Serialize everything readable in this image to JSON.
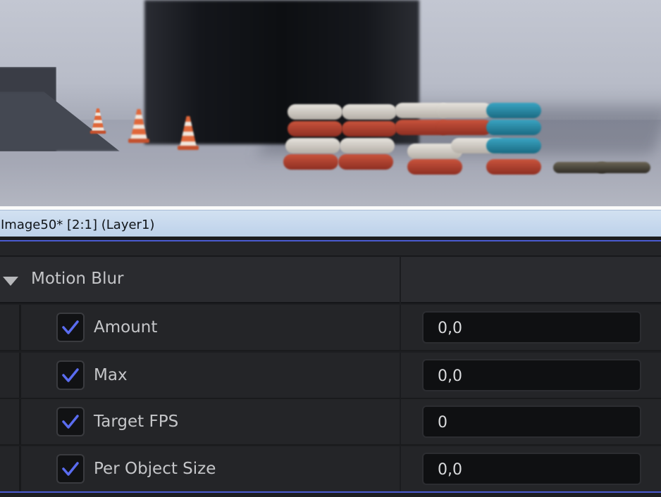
{
  "window": {
    "title": "Image50* [2:1] (Layer1)"
  },
  "panel": {
    "section": {
      "label": "Motion Blur",
      "expanded": true,
      "caret_icon": "caret-down-icon"
    },
    "properties": [
      {
        "label": "Amount",
        "enabled": true,
        "value": "0,0"
      },
      {
        "label": "Max",
        "enabled": true,
        "value": "0,0"
      },
      {
        "label": "Target FPS",
        "enabled": true,
        "value": "0"
      },
      {
        "label": "Per Object Size",
        "enabled": true,
        "value": "0,0"
      }
    ]
  },
  "colors": {
    "accent": "#4b5bd1",
    "check": "#5a6cf0",
    "panel_bg": "#242528",
    "title_bar": "#c8d9ee"
  }
}
